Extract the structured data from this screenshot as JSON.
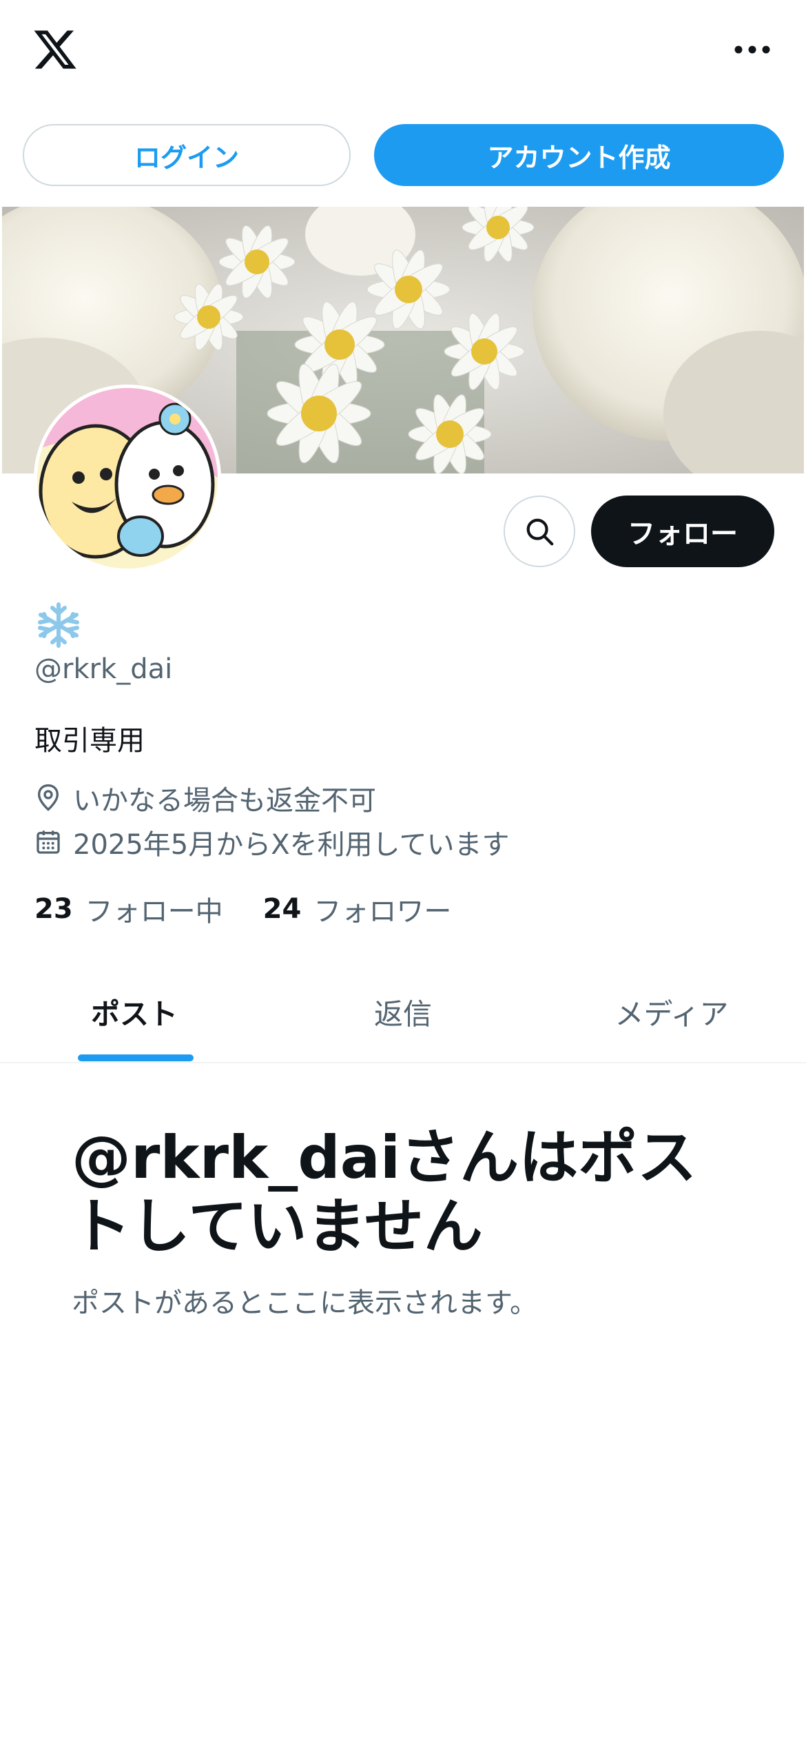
{
  "header": {
    "logo_icon": "x-logo-icon",
    "more_icon": "more-horizontal-icon"
  },
  "auth": {
    "login_label": "ログイン",
    "signup_label": "アカウント作成"
  },
  "profile": {
    "display_name_icon": "snowflake-icon",
    "handle": "@rkrk_dai",
    "bio": "取引専用",
    "location": "いかなる場合も返金不可",
    "joined": "2025年5月からXを利用しています",
    "following_count": "23",
    "following_label": "フォロー中",
    "followers_count": "24",
    "followers_label": "フォロワー"
  },
  "actions": {
    "search_icon": "search-icon",
    "follow_label": "フォロー"
  },
  "tabs": [
    {
      "label": "ポスト",
      "active": true
    },
    {
      "label": "返信",
      "active": false
    },
    {
      "label": "メディア",
      "active": false
    }
  ],
  "empty_state": {
    "title": "@rkrk_daiさんはポストしていません",
    "subtitle": "ポストがあるとここに表示されます。"
  },
  "colors": {
    "accent": "#1d9bf0",
    "text_primary": "#0f1419",
    "text_secondary": "#536471",
    "border": "#cfd9de"
  }
}
